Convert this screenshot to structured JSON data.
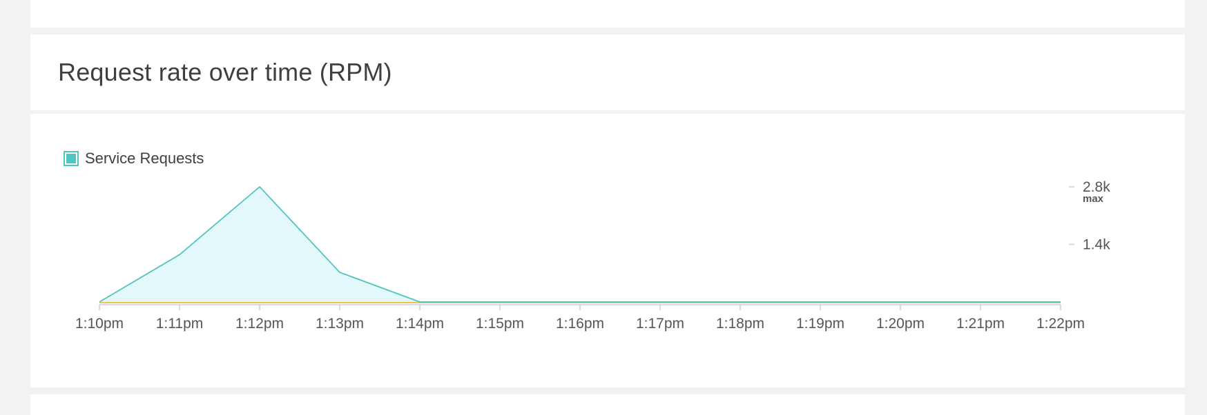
{
  "panel": {
    "title": "Request rate over time (RPM)"
  },
  "legend": {
    "label": "Service Requests"
  },
  "colors": {
    "series_line": "#4fc4c1",
    "series_fill": "#e3f8fa",
    "baseline": "#f0c24b",
    "axis": "#cfcfcf",
    "tick_text": "#555555"
  },
  "chart_data": {
    "type": "area",
    "x": [
      "1:10pm",
      "1:11pm",
      "1:12pm",
      "1:13pm",
      "1:14pm",
      "1:15pm",
      "1:16pm",
      "1:17pm",
      "1:18pm",
      "1:19pm",
      "1:20pm",
      "1:21pm",
      "1:22pm"
    ],
    "series": [
      {
        "name": "Service Requests",
        "values": [
          0,
          1150,
          2800,
          720,
          0,
          0,
          0,
          0,
          0,
          0,
          0,
          0,
          0
        ]
      }
    ],
    "y_ticks": [
      {
        "label": "2.8k",
        "value": 2800,
        "sublabel": "max"
      },
      {
        "label": "1.4k",
        "value": 1400
      }
    ],
    "ylim": [
      0,
      2800
    ],
    "legend_position": "top-left",
    "grid": false
  }
}
